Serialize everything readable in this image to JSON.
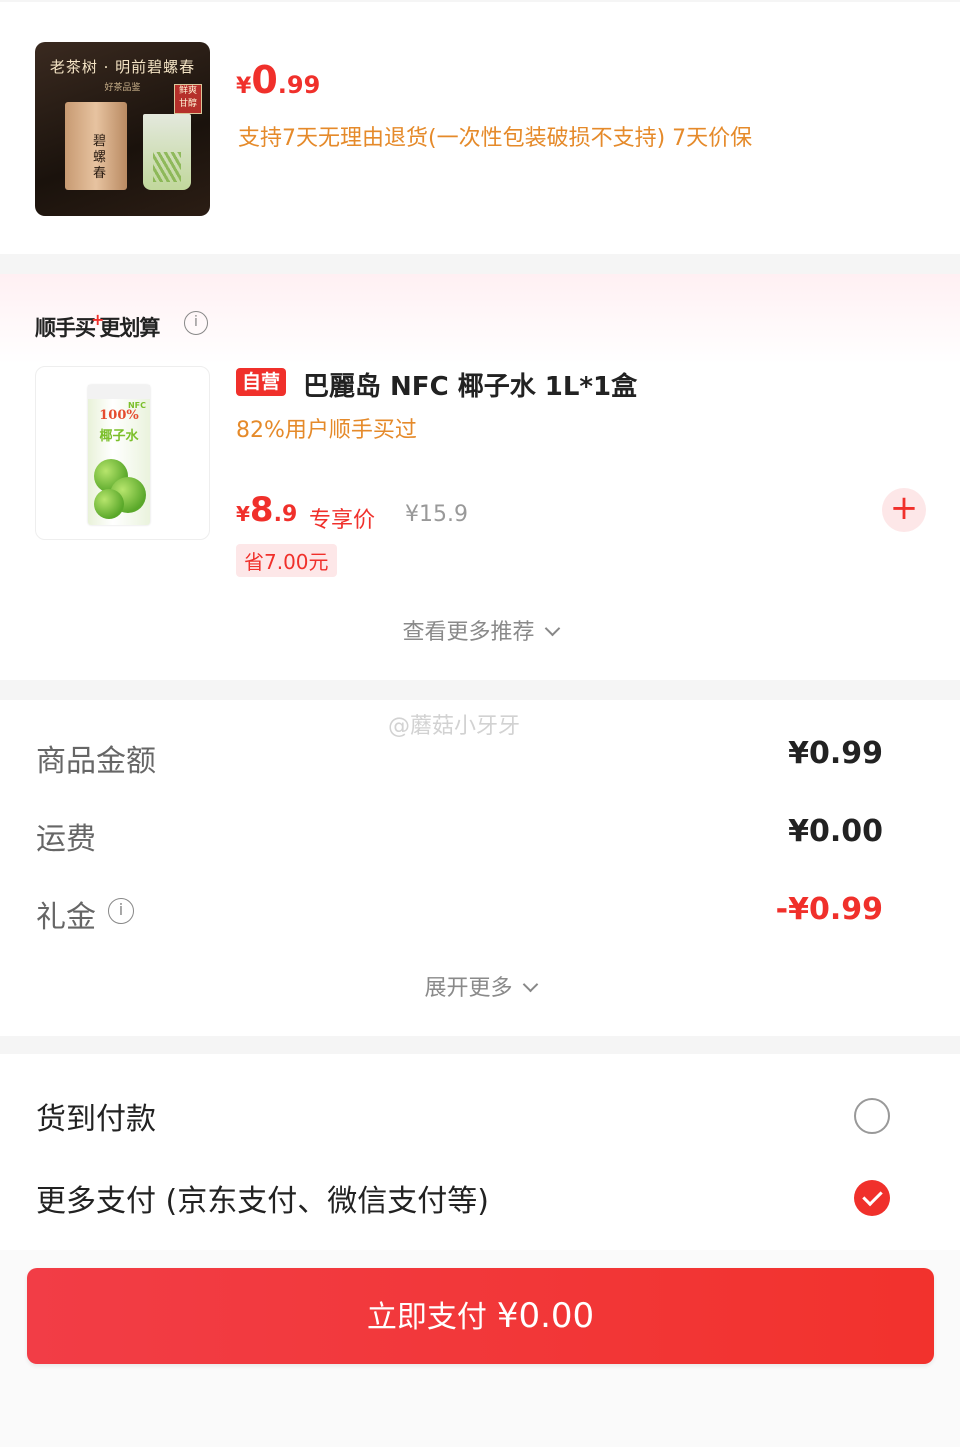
{
  "product": {
    "thumb": {
      "title": "老茶树 · 明前碧螺春",
      "subtitle": "好茶品鉴",
      "badge": "鲜爽甘醇",
      "bag_text": "碧螺春"
    },
    "price_symbol": "¥",
    "price_int": "0",
    "price_dec": ".99",
    "service_note": "支持7天无理由退货(一次性包装破损不支持)  7天价保"
  },
  "recommendation": {
    "title_a": "顺手买",
    "title_plus": "+",
    "title_b": "更划算",
    "info_icon": "i",
    "item": {
      "self_tag": "自营",
      "name": "巴麗岛 NFC 椰子水 1L*1盒",
      "stat": "82%用户顺手买过",
      "price_symbol": "¥",
      "price_int": "8",
      "price_dec": ".9",
      "price_tag": "专享价",
      "original_price": "¥15.9",
      "save": "省7.00元",
      "add_label": "+",
      "thumb": {
        "label": "100%",
        "name": "椰子水",
        "nfc": "NFC"
      }
    },
    "more_label": "查看更多推荐"
  },
  "summary": {
    "watermark": "@蘑菇小牙牙",
    "rows": [
      {
        "label": "商品金额",
        "value": "¥0.99"
      },
      {
        "label": "运费",
        "value": "¥0.00"
      },
      {
        "label": "礼金",
        "value": "-¥0.99"
      }
    ],
    "info_icon": "i",
    "more_label": "展开更多"
  },
  "payment": {
    "options": [
      {
        "label": "货到付款",
        "selected": false
      },
      {
        "label": "更多支付 (京东支付、微信支付等)",
        "selected": true
      }
    ]
  },
  "footer": {
    "pay_label": "立即支付",
    "pay_amount": "¥0.00"
  },
  "colors": {
    "accent": "#f0302b",
    "orange": "#e58a2a",
    "muted": "#8a8a8a"
  }
}
